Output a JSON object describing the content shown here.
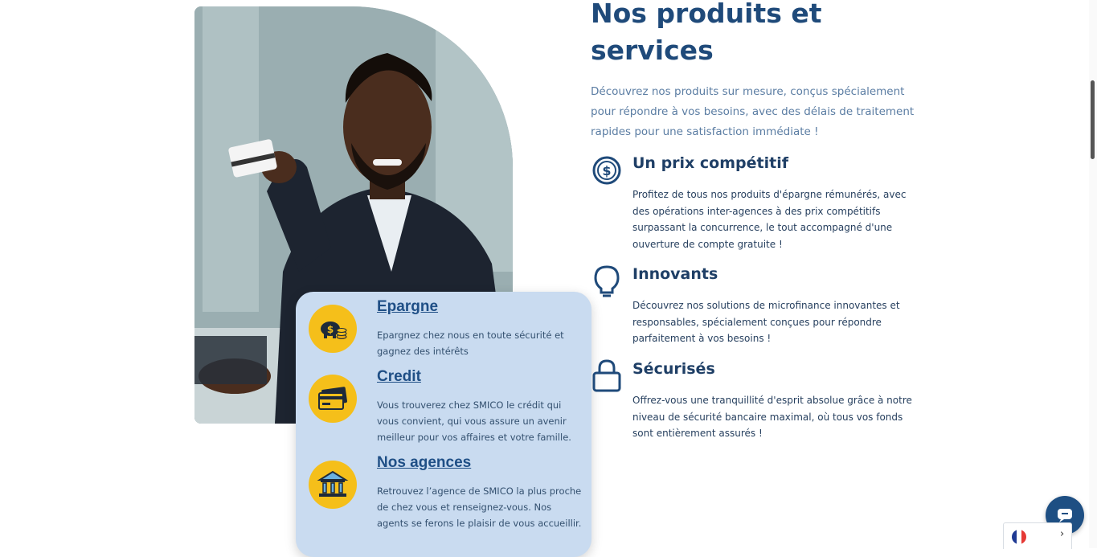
{
  "products_section": {
    "title": "Nos produits et services",
    "intro": "Découvrez nos produits sur mesure, conçus spécialement pour répondre à vos besoins, avec des délais de traitement rapides pour une satisfaction immédiate !",
    "features": [
      {
        "icon": "dollar-circle-icon",
        "title": "Un prix compétitif",
        "description": "Profitez de tous nos produits d'épargne rémunérés, avec des opérations inter-agences à des prix compétitifs surpassant la concurrence, le tout accompagné d'une ouverture de compte gratuite !"
      },
      {
        "icon": "lightbulb-icon",
        "title": "Innovants",
        "description": "Découvrez nos solutions de microfinance innovantes et responsables, spécialement conçues pour répondre parfaitement à vos besoins !"
      },
      {
        "icon": "lock-icon",
        "title": "Sécurisés",
        "description": "Offrez-vous une tranquillité d'esprit absolue grâce à notre niveau de sécurité bancaire maximal, où tous vos fonds sont entièrement assurés !"
      }
    ]
  },
  "services_card": {
    "items": [
      {
        "icon": "piggy-bank-icon",
        "title": "Epargne",
        "description": "Epargnez chez nous en toute sécurité et gagnez des intérêts"
      },
      {
        "icon": "credit-card-icon",
        "title": "Credit",
        "description": "Vous trouverez chez SMICO le crédit qui vous convient, qui vous assure un avenir meilleur pour vos affaires et votre famille."
      },
      {
        "icon": "bank-building-icon",
        "title": "Nos agences",
        "description": "Retrouvez l’agence de SMICO la plus proche de chez vous et renseignez-vous. Nos agents se ferons le plaisir de vous accueillir."
      }
    ]
  },
  "colors": {
    "primary": "#1f4a7a",
    "card_background": "#c9dbf0",
    "badge_yellow": "#f5bf1a",
    "chat_button": "#1e4f83"
  },
  "widgets": {
    "chat_icon": "chat-bubble-icon",
    "language_flag": "france-flag-icon",
    "language_chevron": "›"
  }
}
